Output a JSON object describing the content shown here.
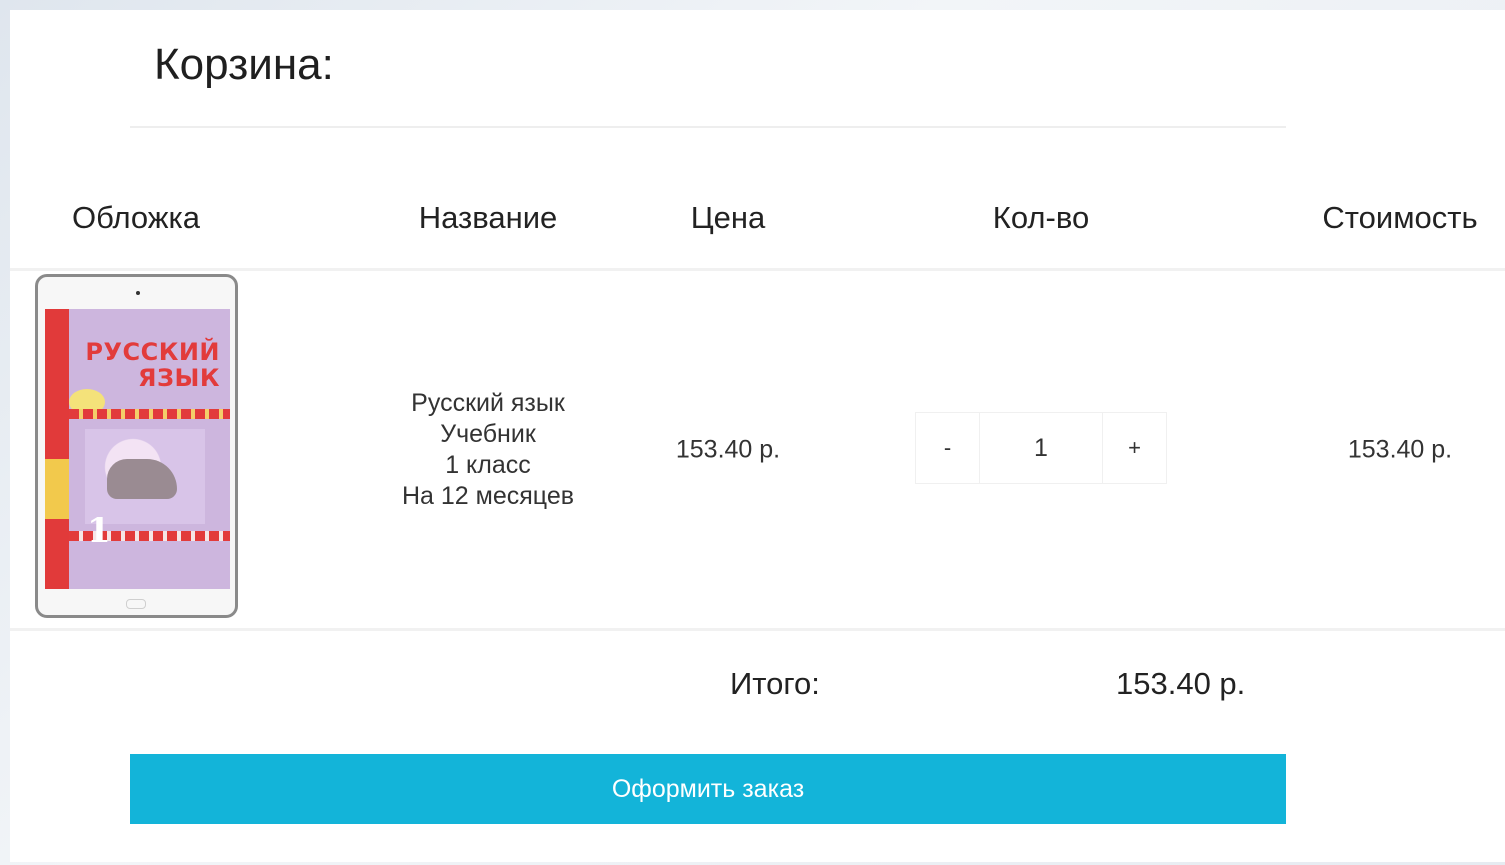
{
  "cart": {
    "title": "Корзина:",
    "columns": {
      "cover": "Обложка",
      "name": "Название",
      "price": "Цена",
      "qty": "Кол-во",
      "cost": "Стоимость"
    },
    "items": [
      {
        "cover_text": "РУССКИЙ ЯЗЫК",
        "cover_grade": "1",
        "name_lines": [
          "Русский язык",
          "Учебник",
          "1 класс",
          "На 12 месяцев"
        ],
        "price": "153.40 р.",
        "qty_minus": "-",
        "qty": "1",
        "qty_plus": "+",
        "cost": "153.40 р."
      }
    ],
    "total_label": "Итого:",
    "total_value": "153.40 р.",
    "checkout_label": "Оформить заказ"
  },
  "colors": {
    "accent": "#13b4d9",
    "cover_red": "#e23b3b",
    "cover_bg": "#cdb6de"
  }
}
